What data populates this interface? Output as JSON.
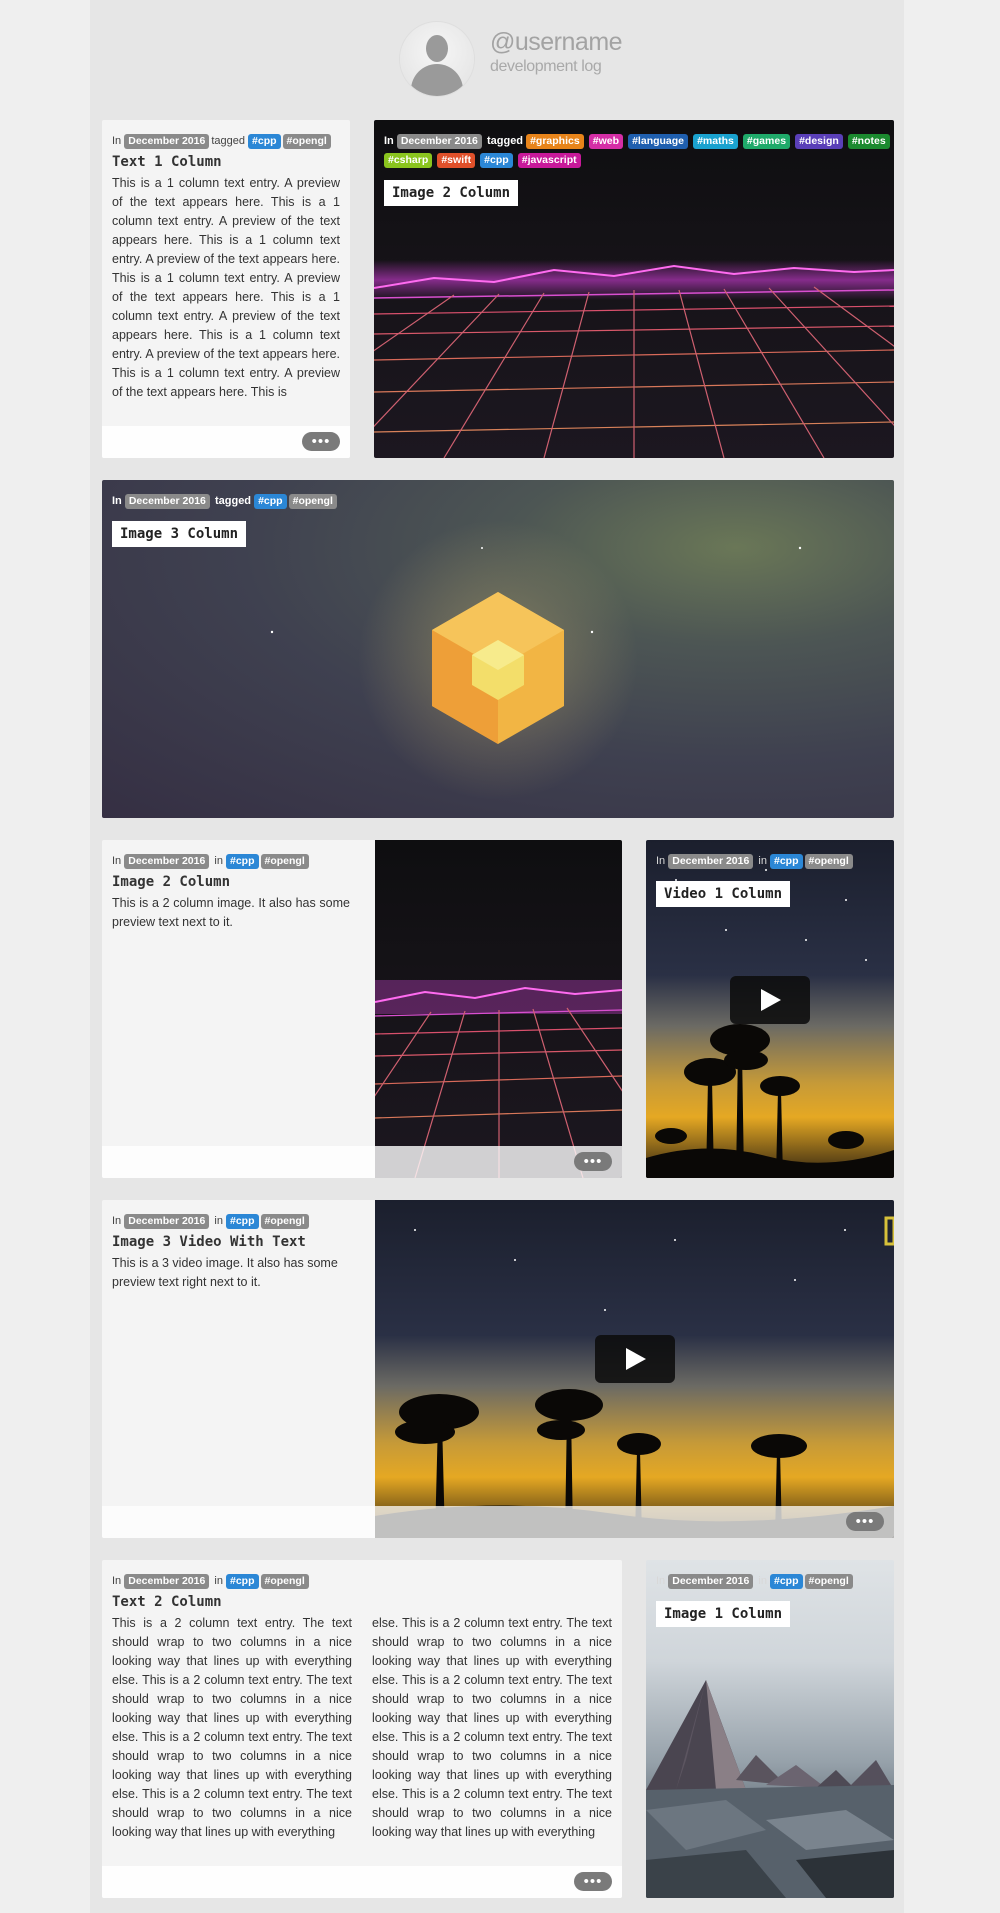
{
  "profile": {
    "username": "@username",
    "subtitle": "development log"
  },
  "tag_colors": {
    "graphics": "#e8841a",
    "web": "#d52ea6",
    "language": "#1f5faf",
    "maths": "#1aa2cf",
    "games": "#1faa6a",
    "design": "#5a3fb8",
    "notes": "#1b8a2f",
    "csharp": "#8ac41e",
    "swift": "#e0502a",
    "cpp": "#2b87d6",
    "javascript": "#c8199a",
    "opengl": "#8a8a8a"
  },
  "posts": [
    {
      "in_label": "In",
      "date": "December 2016",
      "tagged_label": "tagged",
      "tags": [
        "#cpp",
        "#opengl"
      ],
      "title": "Text 1 Column",
      "text": "This is a 1 column text entry. A preview of the text appears here. This is a 1 column text entry. A preview of the text appears here. This is a 1 column text entry. A preview of the text appears here. This is a 1 column text entry. A preview of the text appears here. This is a 1 column text entry. A preview of the text appears here. This is a 1 column text entry. A preview of the text appears here. This is a 1 column text entry. A preview of the text appears here. This is"
    },
    {
      "in_label": "In",
      "date": "December 2016",
      "tagged_label": "tagged",
      "tags": [
        "#graphics",
        "#web",
        "#language",
        "#maths",
        "#games",
        "#design",
        "#notes",
        "#csharp",
        "#swift",
        "#cpp",
        "#javascript"
      ],
      "title": "Image 2 Column"
    },
    {
      "in_label": "In",
      "date": "December 2016",
      "tagged_label": "tagged",
      "tags": [
        "#cpp",
        "#opengl"
      ],
      "title": "Image 3 Column"
    },
    {
      "in_label": "In",
      "date": "December 2016",
      "tagged_label": "in",
      "tags": [
        "#cpp",
        "#opengl"
      ],
      "title": "Image 2 Column",
      "text": "This is a 2 column image. It also has some preview text next to it."
    },
    {
      "in_label": "In",
      "date": "December 2016",
      "tagged_label": "in",
      "tags": [
        "#cpp",
        "#opengl"
      ],
      "title": "Video 1 Column"
    },
    {
      "in_label": "In",
      "date": "December 2016",
      "tagged_label": "in",
      "tags": [
        "#cpp",
        "#opengl"
      ],
      "title": "Image 3 Video With Text",
      "text": "This is a 3 video image. It also has some preview text right next to it."
    },
    {
      "in_label": "In",
      "date": "December 2016",
      "tagged_label": "in",
      "tags": [
        "#cpp",
        "#opengl"
      ],
      "title": "Text 2 Column",
      "text_col1": "This is a 2 column text entry. The text should wrap to two columns in a nice looking way that lines up with everything else. This is a 2 column text entry. The text should wrap to two columns in a nice looking way that lines up with everything else. This is a 2 column text entry. The text should wrap to two columns in a nice looking way that lines up with everything else. This is a 2 column text entry. The text should wrap to two columns in a nice looking way that lines up with everything",
      "text_col2": "else. This is a 2 column text entry. The text should wrap to two columns in a nice looking way that lines up with everything else. This is a 2 column text entry. The text should wrap to two columns in a nice looking way that lines up with everything else. This is a 2 column text entry. The text should wrap to two columns in a nice looking way that lines up with everything else. This is a 2 column text entry. The text should wrap to two columns in a nice looking way that lines up with everything"
    },
    {
      "in_label": "In",
      "date": "December 2016",
      "tagged_label": "in",
      "tags": [
        "#cpp",
        "#opengl"
      ],
      "title": "Image 1 Column"
    }
  ]
}
